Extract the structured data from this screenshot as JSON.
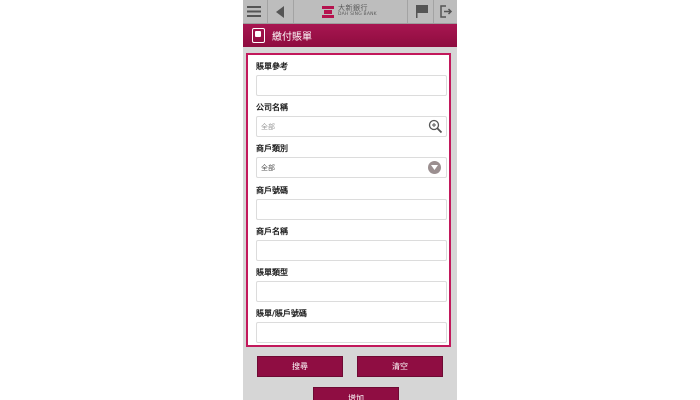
{
  "topbar": {
    "menu_icon": "hamburger-icon",
    "back_icon": "back-arrow-icon",
    "logo": {
      "name_cn": "大新銀行",
      "name_en": "DAH SING BANK"
    },
    "flag_icon": "flag-icon",
    "logout_icon": "logout-icon"
  },
  "page": {
    "title": "繳付賬單",
    "title_icon": "bill-phone-icon"
  },
  "form": {
    "bill_reference": {
      "label": "賬單參考",
      "value": ""
    },
    "company_name": {
      "label": "公司名稱",
      "placeholder": "全部",
      "icon": "search-zoom-icon"
    },
    "merchant_type": {
      "label": "商戶類別",
      "selected": "全部",
      "icon": "chevron-down-icon"
    },
    "merchant_number": {
      "label": "商戶號碼",
      "value": ""
    },
    "merchant_name": {
      "label": "商戶名稱",
      "value": ""
    },
    "bill_type": {
      "label": "賬單類型",
      "value": ""
    },
    "bill_account_number": {
      "label": "賬單/賬戶號碼",
      "value": ""
    }
  },
  "actions": {
    "search": "搜尋",
    "clear": "清空",
    "add": "增加"
  },
  "colors": {
    "brand": "#8f0d42",
    "panel_border": "#c2185b"
  }
}
